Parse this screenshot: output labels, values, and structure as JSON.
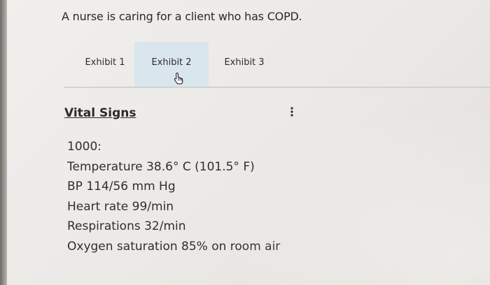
{
  "question": "A nurse is caring for a client who has COPD.",
  "tabs": [
    {
      "label": "Exhibit 1",
      "active": false
    },
    {
      "label": "Exhibit 2",
      "active": true
    },
    {
      "label": "Exhibit 3",
      "active": false
    }
  ],
  "section": {
    "title": "Vital Signs",
    "time": "1000:",
    "readings": [
      "Temperature 38.6° C (101.5° F)",
      "BP 114/56 mm Hg",
      "Heart rate 99/min",
      "Respirations 32/min",
      "Oxygen saturation 85% on room air"
    ]
  },
  "icons": {
    "cursor": "hand-pointer-icon",
    "menu": "more-vertical-icon"
  },
  "colors": {
    "active_tab_bg": "#d9e6ee",
    "active_tab_underline": "#2c6b97",
    "background": "#efedea",
    "text": "#2b2b2b"
  }
}
